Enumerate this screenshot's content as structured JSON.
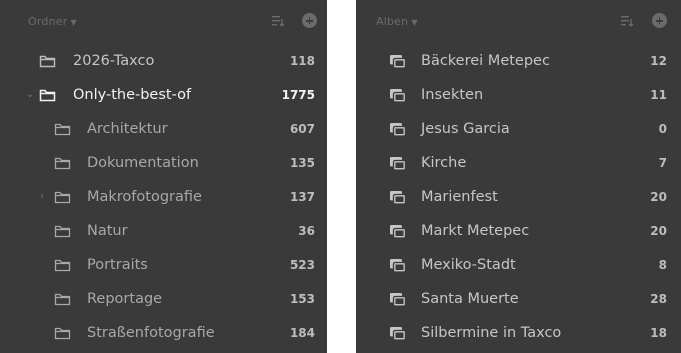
{
  "folders_panel": {
    "title": "Ordner",
    "items": [
      {
        "label": "2026-Taxco",
        "count": "118"
      },
      {
        "label": "Only-the-best-of",
        "count": "1775"
      },
      {
        "label": "Architektur",
        "count": "607"
      },
      {
        "label": "Dokumentation",
        "count": "135"
      },
      {
        "label": "Makrofotografie",
        "count": "137"
      },
      {
        "label": "Natur",
        "count": "36"
      },
      {
        "label": "Portraits",
        "count": "523"
      },
      {
        "label": "Reportage",
        "count": "153"
      },
      {
        "label": "Straßenfotografie",
        "count": "184"
      }
    ]
  },
  "albums_panel": {
    "title": "Alben",
    "items": [
      {
        "label": "Bäckerei Metepec",
        "count": "12"
      },
      {
        "label": "Insekten",
        "count": "11"
      },
      {
        "label": "Jesus Garcia",
        "count": "0"
      },
      {
        "label": "Kirche",
        "count": "7"
      },
      {
        "label": "Marienfest",
        "count": "20"
      },
      {
        "label": "Markt Metepec",
        "count": "20"
      },
      {
        "label": "Mexiko-Stadt",
        "count": "8"
      },
      {
        "label": "Santa Muerte",
        "count": "28"
      },
      {
        "label": "Silbermine in Taxco",
        "count": "18"
      }
    ]
  },
  "icons": {
    "folder": "folder-icon",
    "album": "album-icon",
    "sort": "sort-icon",
    "add": "add-icon",
    "disclosure": "chevron-icon"
  },
  "colors": {
    "panel_bg": "#3a3a3a",
    "text": "#c6c6c6",
    "active_text": "#f2f2f2",
    "header_text": "#6a6a6a"
  }
}
